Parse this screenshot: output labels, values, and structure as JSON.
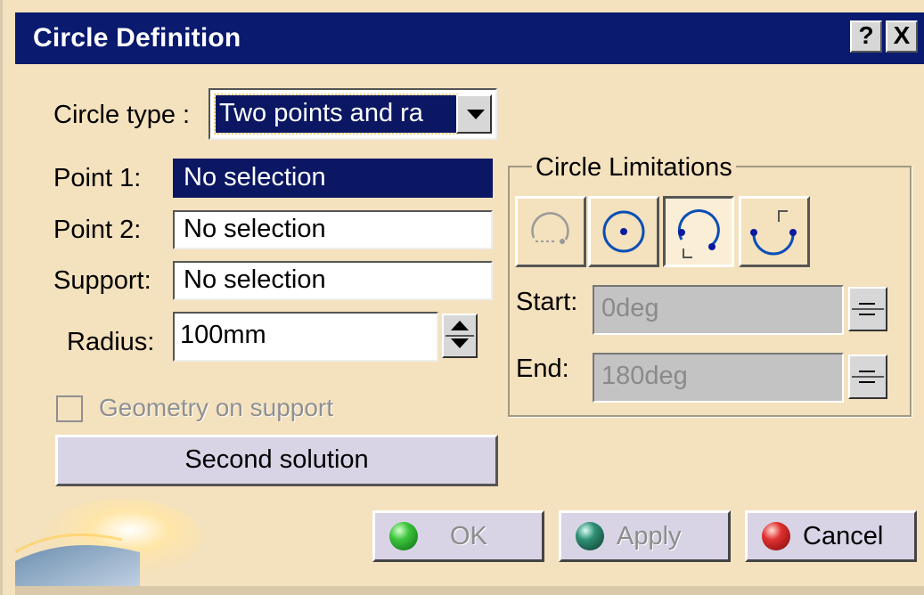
{
  "window": {
    "title": "Circle Definition",
    "help_label": "?",
    "close_label": "X"
  },
  "form": {
    "circle_type_label": "Circle type :",
    "circle_type_value": "Two points and ra",
    "point1_label": "Point 1:",
    "point1_value": "No selection",
    "point2_label": "Point 2:",
    "point2_value": "No selection",
    "support_label": "Support:",
    "support_value": "No selection",
    "radius_label": "Radius:",
    "radius_value": "100mm",
    "geometry_on_support_label": "Geometry on support",
    "geometry_on_support_checked": false,
    "second_solution_label": "Second solution"
  },
  "limitations": {
    "group_title": "Circle Limitations",
    "modes": [
      "part-arc",
      "whole-circle",
      "trimmed-circle",
      "complementary-circle"
    ],
    "selected_mode": "trimmed-circle",
    "start_label": "Start:",
    "start_value": "0deg",
    "end_label": "End:",
    "end_value": "180deg"
  },
  "buttons": {
    "ok_label": "OK",
    "apply_label": "Apply",
    "cancel_label": "Cancel"
  },
  "colors": {
    "title_bar": "#0a1a6e",
    "dialog_bg": "#f4e1bd",
    "selection": "#0b1763",
    "ok_ball": "#1fa81f",
    "apply_ball": "#1a5e4a",
    "cancel_ball": "#d81e1e"
  }
}
